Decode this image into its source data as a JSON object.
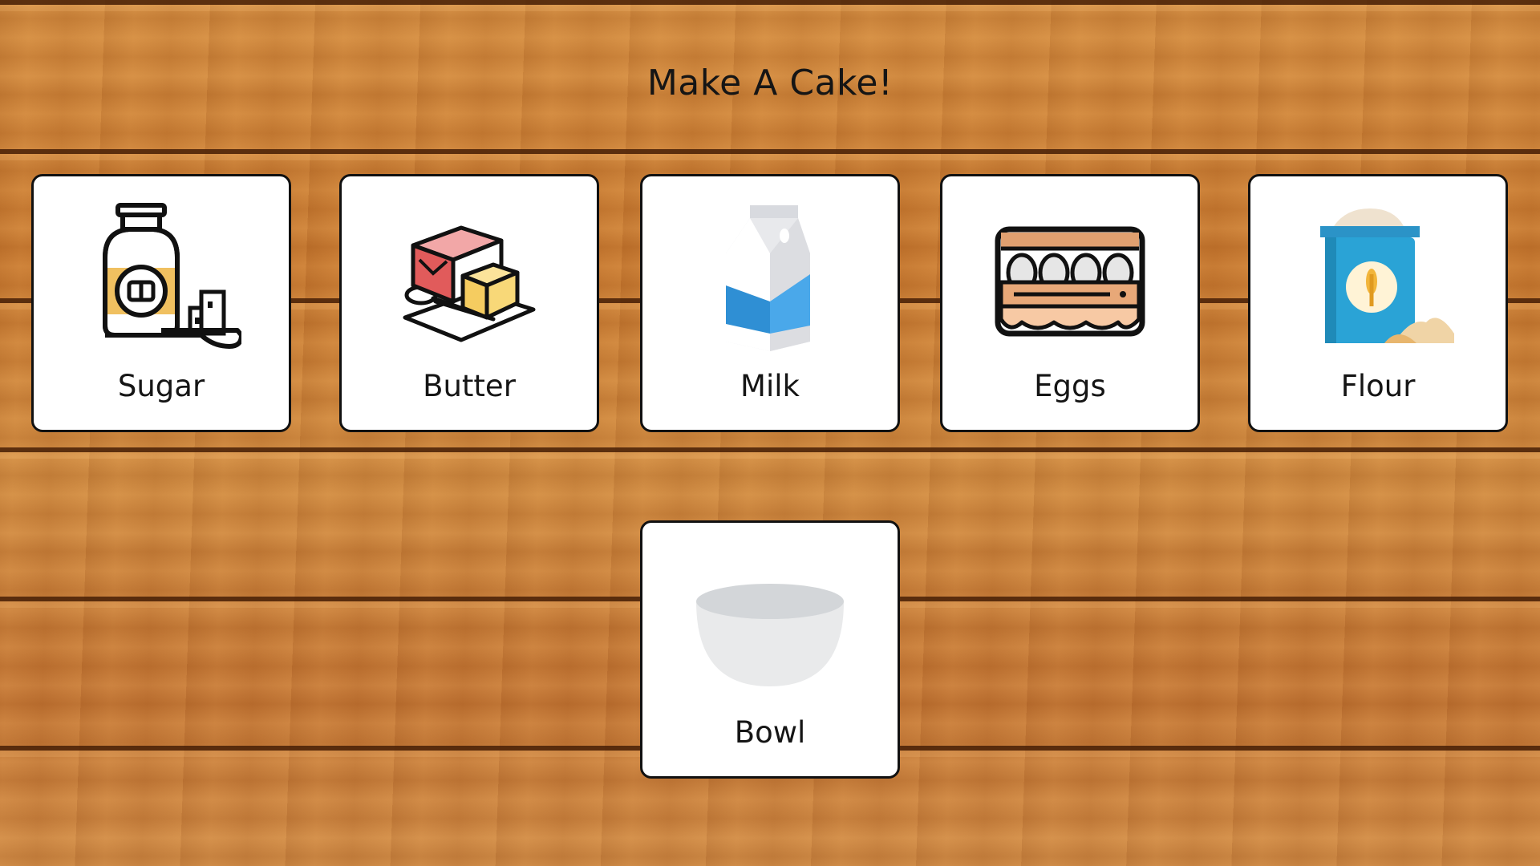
{
  "page": {
    "title": "Make A Cake!"
  },
  "ingredients": [
    {
      "label": "Sugar",
      "icon": "sugar-jar-icon"
    },
    {
      "label": "Butter",
      "icon": "butter-icon"
    },
    {
      "label": "Milk",
      "icon": "milk-carton-icon"
    },
    {
      "label": "Eggs",
      "icon": "egg-carton-icon"
    },
    {
      "label": "Flour",
      "icon": "flour-sack-icon"
    }
  ],
  "tool": {
    "label": "Bowl",
    "icon": "bowl-icon"
  },
  "colors": {
    "card_background": "#ffffff",
    "card_border": "#111111",
    "text": "#151515",
    "wood": "#c27a34"
  }
}
